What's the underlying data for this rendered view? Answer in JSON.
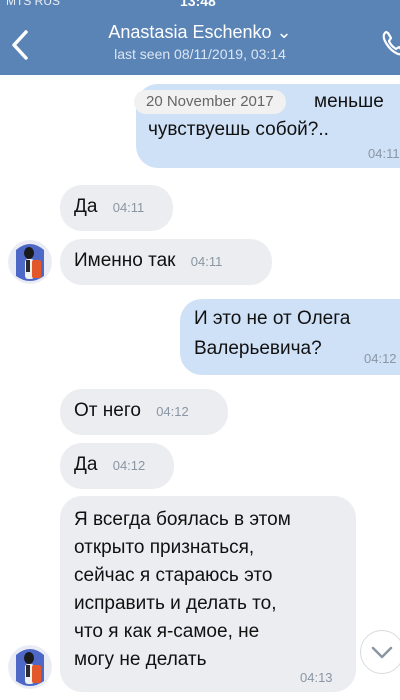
{
  "status": {
    "carrier": "MTS RUS",
    "time": "13:48"
  },
  "header": {
    "contact_name": "Anastasia Eschenko ⌄",
    "last_seen": "last seen 08/11/2019, 03:14"
  },
  "date_separator": "20 November 2017",
  "messages": [
    {
      "dir": "out",
      "text_line1": "меньше",
      "text_line2": "чувствуешь собой?..",
      "time": "04:11"
    },
    {
      "dir": "in",
      "text": "Да",
      "time": "04:11"
    },
    {
      "dir": "in",
      "text": "Именно так",
      "time": "04:11"
    },
    {
      "dir": "out",
      "text_line1": "И это не от Олега",
      "text_line2": "Валерьевича?",
      "time": "04:12"
    },
    {
      "dir": "in",
      "text": "От него",
      "time": "04:12"
    },
    {
      "dir": "in",
      "text": "Да",
      "time": "04:12"
    },
    {
      "dir": "in",
      "lines": [
        "Я всегда боялась в этом",
        "открыто признаться,",
        "сейчас я стараюсь это",
        "исправить и делать то,",
        "что я как я-самое, не",
        "могу не делать"
      ],
      "time": "04:13"
    }
  ],
  "colors": {
    "header": "#5b84b6",
    "incoming": "#ebedf0",
    "outgoing": "#cfe1f7"
  },
  "icons": {
    "back": "chevron-left-icon",
    "call": "phone-icon",
    "scroll": "chevron-down-icon"
  }
}
